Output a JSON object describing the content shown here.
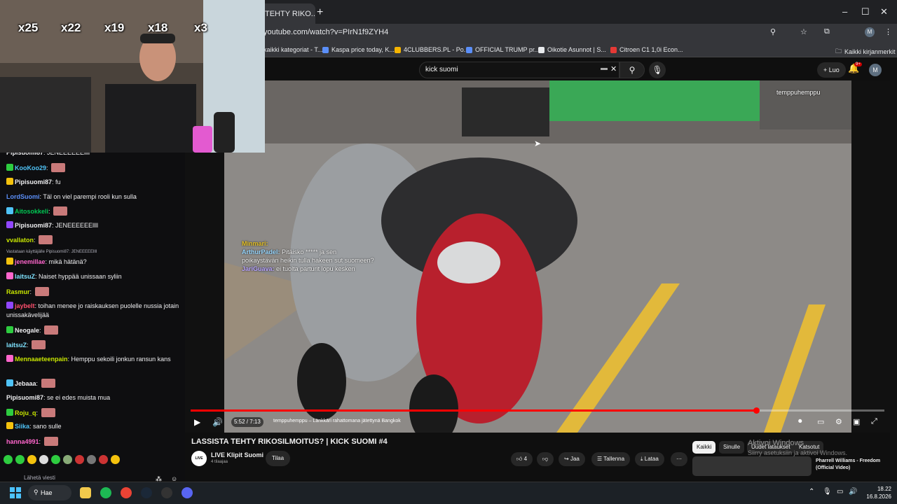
{
  "browser": {
    "tab_title": "TEHTY RIKO...",
    "new_tab": "+",
    "url": "youtube.com/watch?v=PIrN1f9ZYH4",
    "bookmarks": [
      "kaikki kategoriat - T...",
      "Kaspa price today, K...",
      "4CLUBBERS.PL - Po...",
      "OFFICIAL TRUMP pr...",
      "Oikotie Asunnot | S...",
      "Citroen C1 1,0i Econ..."
    ],
    "all_bookmarks": "Kaikki kirjanmerkit",
    "window_controls": [
      "–",
      "☐",
      "✕"
    ]
  },
  "youtube": {
    "search_value": "kick suomi",
    "create_label": "+ Luo",
    "notification_count": "9+",
    "avatar_letter": "M",
    "video_title": "LASSISTA TEHTY RIKOSILMOITUS? | KICK SUOMI #4",
    "channel_name": "LIVE Klipit Suomi",
    "channel_avatar_text": "LIVE",
    "channel_subs": "4 tilaajaa",
    "subscribe_label": "Tilaa",
    "like_label": "4",
    "share_label": "Jaa",
    "save_label": "Tallenna",
    "download_label": "Lataa",
    "more_label": "⋯",
    "chips": [
      "Kaikki",
      "Sinulle",
      "Uudet lataukset",
      "Katsotut"
    ],
    "activate_windows_title": "Aktivoi Windows",
    "activate_windows_sub": "Siirry asetuksiin ja aktivoi Windows.",
    "recommended_title": "Pharrell Williams - Freedom (Official Video)"
  },
  "player": {
    "time": "5:52 / 7:13",
    "chapter": "temppuhemppu – Länkkäri rahattomana jätettynä Bangkok",
    "progress_fraction": 0.815,
    "watermark": "temppuhemppu",
    "overlay_chat": [
      {
        "user": "Minmari",
        "text": "",
        "color": "#e6c229"
      },
      {
        "user": "ArthurPadel",
        "text": "Pitäisko ***** ja sen poikaystävän heikin tulla hakeen sut suomeen?",
        "color": "#9ad8ff"
      },
      {
        "user": "JariGuava",
        "text": "ei tuolta parturit lopu kesken",
        "color": "#b9a6ff"
      }
    ]
  },
  "webcam": {
    "multipliers": [
      "x25",
      "x22",
      "x19",
      "x18",
      "x3"
    ]
  },
  "chat": {
    "messages": [
      {
        "user": "Pipisuomi87",
        "text": "JENEEEEEEllll",
        "color": "#efeff1"
      },
      {
        "user": "KooKoo29",
        "text": "",
        "color": "#4fc3f7"
      },
      {
        "user": "Pipisuomi87",
        "text": "fu",
        "color": "#efeff1"
      },
      {
        "user": "LordSuomi",
        "text": "Täl on viel parempi rooli kun sulla",
        "color": "#5b8ff9"
      },
      {
        "user": "Aitosokkeli",
        "text": "",
        "color": "#00c853"
      },
      {
        "user": "Pipisuomi87",
        "text": "JENEEEEEEllll",
        "color": "#efeff1"
      },
      {
        "user": "vvallaton",
        "text": "",
        "color": "#c8e600"
      },
      {
        "user": "jenemillae",
        "text": "mikä hätänä?",
        "color": "#ff66cc"
      },
      {
        "user": "laitsuZ",
        "text": "Naiset hyppää unissaan syliin",
        "color": "#7fe3ff"
      },
      {
        "user": "Rasmur",
        "text": "",
        "color": "#c8e600"
      },
      {
        "user": "jaybelt",
        "text": "toihan menee jo raiskauksen puolelle nussia jotain unissakävelijää",
        "color": "#ff4f6d"
      },
      {
        "user": "Neogale",
        "text": "",
        "color": "#efeff1"
      },
      {
        "user": "laitsuZ",
        "text": "",
        "color": "#7fe3ff"
      },
      {
        "user": "Mennaaeteenpain",
        "text": "Hemppu sekoili jonkun ransun kans",
        "color": "#c8e600"
      },
      {
        "user": "Jebaaa",
        "text": "",
        "color": "#efeff1"
      },
      {
        "user": "Pipisuomi87",
        "text": "se ei edes muista mua",
        "color": "#efeff1"
      },
      {
        "user": "Roju_q",
        "text": "",
        "color": "#c8e600"
      },
      {
        "user": "Siika",
        "text": "sano sulle",
        "color": "#4fc3f7"
      },
      {
        "user": "hanna4991",
        "text": "",
        "color": "#ff66cc"
      }
    ],
    "reply_context": "Vastataan käyttäjälle Pipisuomi87: JENEEEEEllll",
    "input_placeholder": "Lähetä viesti"
  },
  "taskbar": {
    "search_label": "Hae",
    "time": "18.22",
    "date": "16.8.2026"
  }
}
